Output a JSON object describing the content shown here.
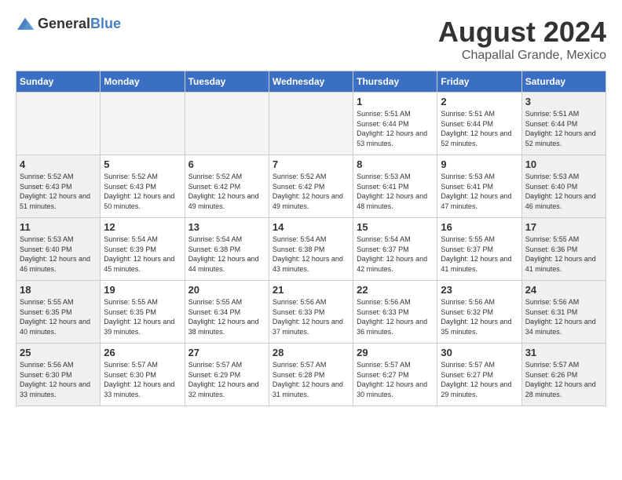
{
  "header": {
    "logo_general": "General",
    "logo_blue": "Blue",
    "month_year": "August 2024",
    "location": "Chapallal Grande, Mexico"
  },
  "weekdays": [
    "Sunday",
    "Monday",
    "Tuesday",
    "Wednesday",
    "Thursday",
    "Friday",
    "Saturday"
  ],
  "weeks": [
    [
      {
        "day": "",
        "empty": true
      },
      {
        "day": "",
        "empty": true
      },
      {
        "day": "",
        "empty": true
      },
      {
        "day": "",
        "empty": true
      },
      {
        "day": "1",
        "sunrise": "5:51 AM",
        "sunset": "6:44 PM",
        "daylight": "12 hours and 53 minutes."
      },
      {
        "day": "2",
        "sunrise": "5:51 AM",
        "sunset": "6:44 PM",
        "daylight": "12 hours and 52 minutes."
      },
      {
        "day": "3",
        "sunrise": "5:51 AM",
        "sunset": "6:44 PM",
        "daylight": "12 hours and 52 minutes."
      }
    ],
    [
      {
        "day": "4",
        "sunrise": "5:52 AM",
        "sunset": "6:43 PM",
        "daylight": "12 hours and 51 minutes."
      },
      {
        "day": "5",
        "sunrise": "5:52 AM",
        "sunset": "6:43 PM",
        "daylight": "12 hours and 50 minutes."
      },
      {
        "day": "6",
        "sunrise": "5:52 AM",
        "sunset": "6:42 PM",
        "daylight": "12 hours and 49 minutes."
      },
      {
        "day": "7",
        "sunrise": "5:52 AM",
        "sunset": "6:42 PM",
        "daylight": "12 hours and 49 minutes."
      },
      {
        "day": "8",
        "sunrise": "5:53 AM",
        "sunset": "6:41 PM",
        "daylight": "12 hours and 48 minutes."
      },
      {
        "day": "9",
        "sunrise": "5:53 AM",
        "sunset": "6:41 PM",
        "daylight": "12 hours and 47 minutes."
      },
      {
        "day": "10",
        "sunrise": "5:53 AM",
        "sunset": "6:40 PM",
        "daylight": "12 hours and 46 minutes."
      }
    ],
    [
      {
        "day": "11",
        "sunrise": "5:53 AM",
        "sunset": "6:40 PM",
        "daylight": "12 hours and 46 minutes."
      },
      {
        "day": "12",
        "sunrise": "5:54 AM",
        "sunset": "6:39 PM",
        "daylight": "12 hours and 45 minutes."
      },
      {
        "day": "13",
        "sunrise": "5:54 AM",
        "sunset": "6:38 PM",
        "daylight": "12 hours and 44 minutes."
      },
      {
        "day": "14",
        "sunrise": "5:54 AM",
        "sunset": "6:38 PM",
        "daylight": "12 hours and 43 minutes."
      },
      {
        "day": "15",
        "sunrise": "5:54 AM",
        "sunset": "6:37 PM",
        "daylight": "12 hours and 42 minutes."
      },
      {
        "day": "16",
        "sunrise": "5:55 AM",
        "sunset": "6:37 PM",
        "daylight": "12 hours and 41 minutes."
      },
      {
        "day": "17",
        "sunrise": "5:55 AM",
        "sunset": "6:36 PM",
        "daylight": "12 hours and 41 minutes."
      }
    ],
    [
      {
        "day": "18",
        "sunrise": "5:55 AM",
        "sunset": "6:35 PM",
        "daylight": "12 hours and 40 minutes."
      },
      {
        "day": "19",
        "sunrise": "5:55 AM",
        "sunset": "6:35 PM",
        "daylight": "12 hours and 39 minutes."
      },
      {
        "day": "20",
        "sunrise": "5:55 AM",
        "sunset": "6:34 PM",
        "daylight": "12 hours and 38 minutes."
      },
      {
        "day": "21",
        "sunrise": "5:56 AM",
        "sunset": "6:33 PM",
        "daylight": "12 hours and 37 minutes."
      },
      {
        "day": "22",
        "sunrise": "5:56 AM",
        "sunset": "6:33 PM",
        "daylight": "12 hours and 36 minutes."
      },
      {
        "day": "23",
        "sunrise": "5:56 AM",
        "sunset": "6:32 PM",
        "daylight": "12 hours and 35 minutes."
      },
      {
        "day": "24",
        "sunrise": "5:56 AM",
        "sunset": "6:31 PM",
        "daylight": "12 hours and 34 minutes."
      }
    ],
    [
      {
        "day": "25",
        "sunrise": "5:56 AM",
        "sunset": "6:30 PM",
        "daylight": "12 hours and 33 minutes."
      },
      {
        "day": "26",
        "sunrise": "5:57 AM",
        "sunset": "6:30 PM",
        "daylight": "12 hours and 33 minutes."
      },
      {
        "day": "27",
        "sunrise": "5:57 AM",
        "sunset": "6:29 PM",
        "daylight": "12 hours and 32 minutes."
      },
      {
        "day": "28",
        "sunrise": "5:57 AM",
        "sunset": "6:28 PM",
        "daylight": "12 hours and 31 minutes."
      },
      {
        "day": "29",
        "sunrise": "5:57 AM",
        "sunset": "6:27 PM",
        "daylight": "12 hours and 30 minutes."
      },
      {
        "day": "30",
        "sunrise": "5:57 AM",
        "sunset": "6:27 PM",
        "daylight": "12 hours and 29 minutes."
      },
      {
        "day": "31",
        "sunrise": "5:57 AM",
        "sunset": "6:26 PM",
        "daylight": "12 hours and 28 minutes."
      }
    ]
  ]
}
